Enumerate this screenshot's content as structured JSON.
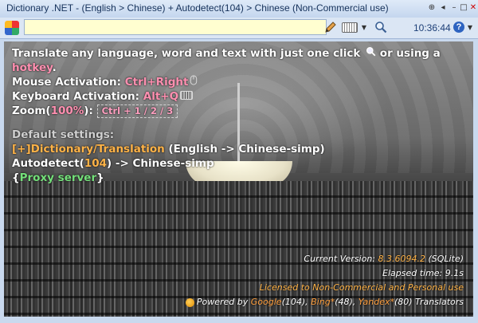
{
  "window": {
    "title": "Dictionary .NET - (English > Chinese) + Autodetect(104) > Chinese (Non-Commercial use)"
  },
  "toolbar": {
    "search_value": "",
    "time": "10:36:44"
  },
  "content": {
    "line1_a": "Translate any language, word and text with just one click",
    "line1_b": " or using a",
    "hotkey": "hotkey",
    "hotkey_end": ".",
    "mouse_label": "Mouse Activation: ",
    "mouse_value": "Ctrl+Right",
    "keyboard_label": "Keyboard Activation: ",
    "keyboard_value": "Alt+Q",
    "zoom_label": "Zoom(",
    "zoom_value": "100%",
    "zoom_end": "): ",
    "zoom_keys": "Ctrl + 1 / 2 / 3",
    "defaults_heading": "Default settings:",
    "dict_link": "[+]Dictionary/Translation",
    "dict_pair": " (English -> Chinese-simp)",
    "autodetect_a": "Autodetect(",
    "autodetect_count": "104",
    "autodetect_b": ") -> Chinese-simp",
    "proxy_open": "{",
    "proxy": "Proxy server",
    "proxy_close": "}"
  },
  "footer": {
    "version_label": "Current Version: ",
    "version": "8.3.6094.2",
    "version_db": " (SQLite)",
    "elapsed": "Elapsed time: 9.1s",
    "license": "Licensed to Non-Commercial and Personal use",
    "powered_by": "Powered by ",
    "google": "Google",
    "google_count": "(104), ",
    "bing": "Bing*",
    "bing_count": "(48), ",
    "yandex": "Yandex*",
    "yandex_count": "(80) Translators"
  },
  "colors": {
    "accent_pink": "#ff8fb0",
    "accent_orange": "#ffb347",
    "accent_green": "#74e07a"
  },
  "icons": [
    "app-logo-icon",
    "pencil-icon",
    "keyboard-icon",
    "chevron-down-icon",
    "magnifier-icon",
    "help-icon",
    "mouse-icon",
    "powered-icon"
  ]
}
